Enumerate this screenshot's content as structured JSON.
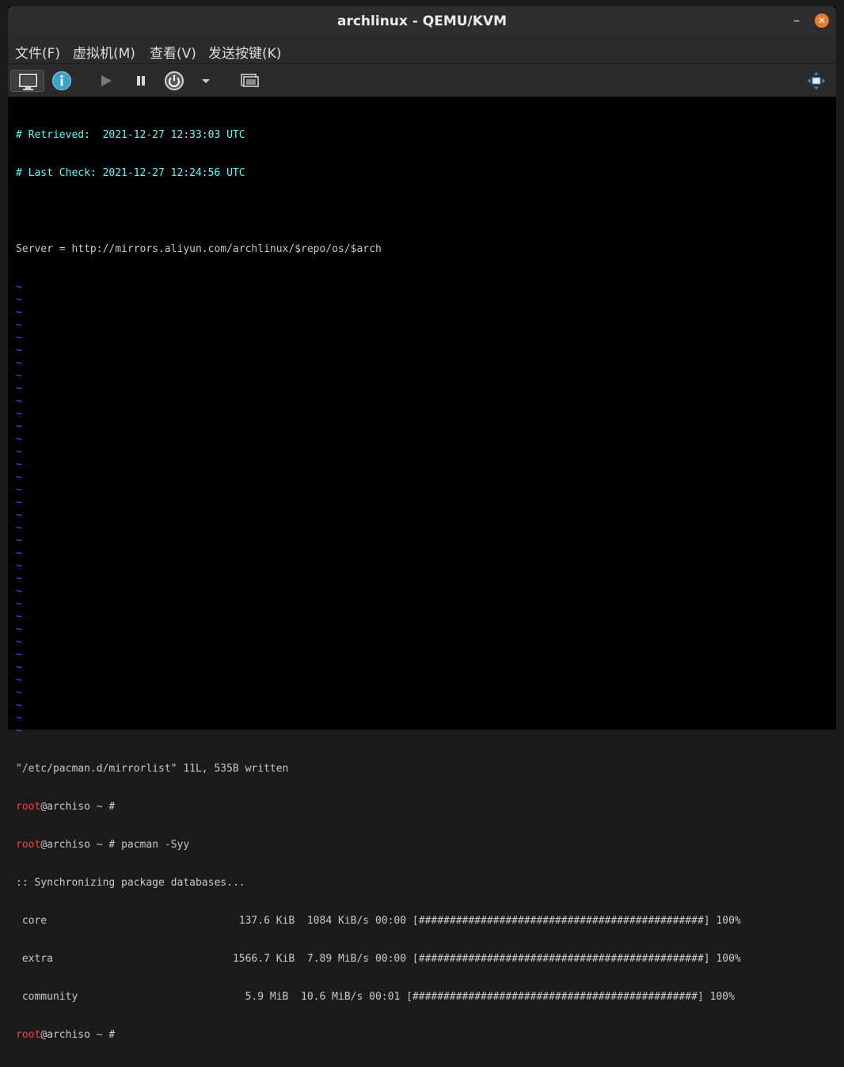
{
  "window": {
    "title": "archlinux - QEMU/KVM",
    "minimize_glyph": "–",
    "close_glyph": "✕"
  },
  "menu": {
    "file": "文件(F)",
    "vm": "虚拟机(M)",
    "view": "查看(V)",
    "sendkey": "发送按键(K)"
  },
  "toolbar": {
    "console_icon": "monitor-icon",
    "details_icon": "info-icon",
    "run_icon": "play-icon",
    "pause_icon": "pause-icon",
    "shutdown_icon": "power-icon",
    "shutdown_menu_icon": "dropdown-arrow-icon",
    "snapshot_icon": "snapshot-icon",
    "fullscreen_icon": "fullscreen-icon"
  },
  "terminal": {
    "retrieved": "# Retrieved:  2021-12-27 12:33:03 UTC",
    "last_check": "# Last Check: 2021-12-27 12:24:56 UTC",
    "server": "Server = http://mirrors.aliyun.com/archlinux/$repo/os/$arch",
    "tilde": "~",
    "tilde_count": 36,
    "written": "\"/etc/pacman.d/mirrorlist\" 11L, 535B written",
    "prompt_user": "root",
    "prompt_host": "@archiso ",
    "prompt_tail": "~ #",
    "command": "~ # pacman -Syy",
    "sync": ":: Synchronizing package databases...",
    "rows": [
      {
        "name": " core",
        "line": "                               137.6 KiB  1084 KiB/s 00:00 [##############################################] 100%"
      },
      {
        "name": " extra",
        "line": "                             1566.7 KiB  7.89 MiB/s 00:00 [##############################################] 100%"
      },
      {
        "name": " community",
        "line": "                           5.9 MiB  10.6 MiB/s 00:01 [##############################################] 100%"
      }
    ]
  },
  "colors": {
    "terminal_cyan": "#55ffff",
    "vim_tilde_blue": "#5555ff",
    "root_red": "#ff4040",
    "close_orange": "#e67c31"
  }
}
